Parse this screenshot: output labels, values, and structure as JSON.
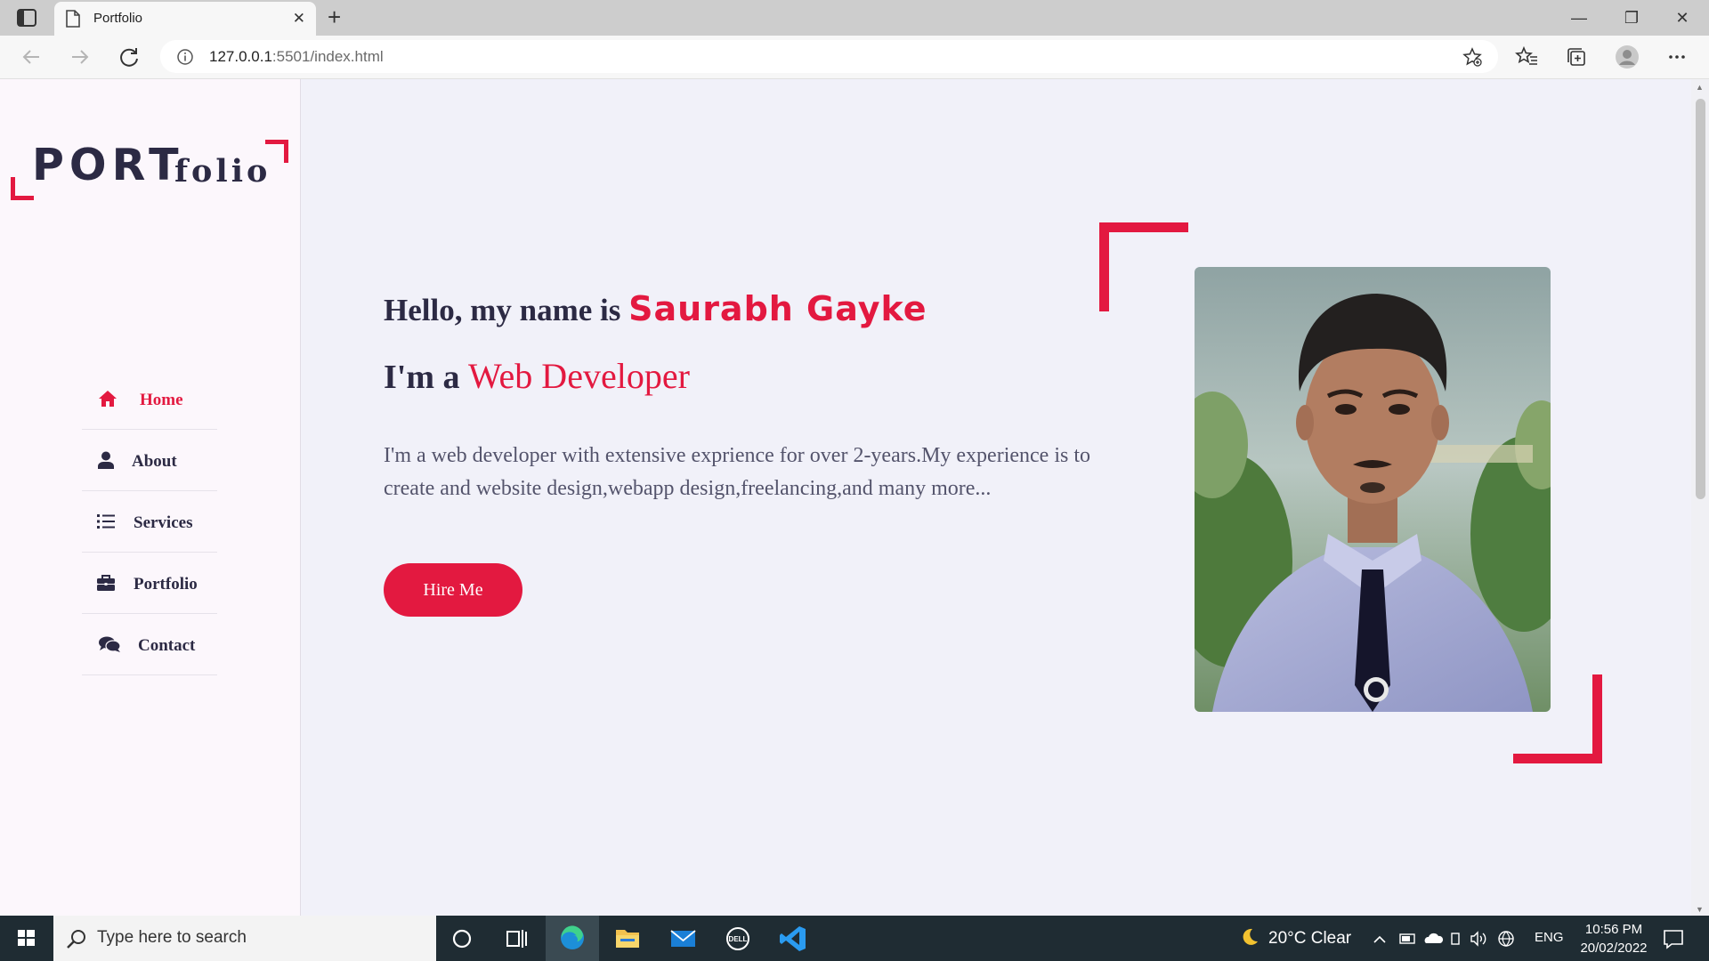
{
  "browser": {
    "tab_title": "Portfolio",
    "url_host": "127.0.0.1",
    "url_rest": ":5501/index.html"
  },
  "logo": {
    "port": "PORT",
    "folio": "folio"
  },
  "nav": {
    "items": [
      {
        "label": "Home",
        "icon": "home-icon",
        "active": true
      },
      {
        "label": "About",
        "icon": "user-icon",
        "active": false
      },
      {
        "label": "Services",
        "icon": "list-icon",
        "active": false
      },
      {
        "label": "Portfolio",
        "icon": "briefcase-icon",
        "active": false
      },
      {
        "label": "Contact",
        "icon": "comments-icon",
        "active": false
      }
    ]
  },
  "hero": {
    "greeting": "Hello, my name is ",
    "name": "Saurabh Gayke",
    "role_prefix": "I'm a ",
    "role": "Web Developer",
    "bio": "I'm a web developer with extensive exprience for over 2-years.My experience is to create and website design,webapp design,freelancing,and many more...",
    "cta": "Hire Me"
  },
  "colors": {
    "accent": "#e31940",
    "text": "#2c2a44",
    "sidebar_bg": "#fcf7fc",
    "main_bg": "#f1f1f9"
  },
  "taskbar": {
    "search_placeholder": "Type here to search",
    "weather": "20°C  Clear",
    "language": "ENG",
    "time": "10:56 PM",
    "date": "20/02/2022"
  }
}
